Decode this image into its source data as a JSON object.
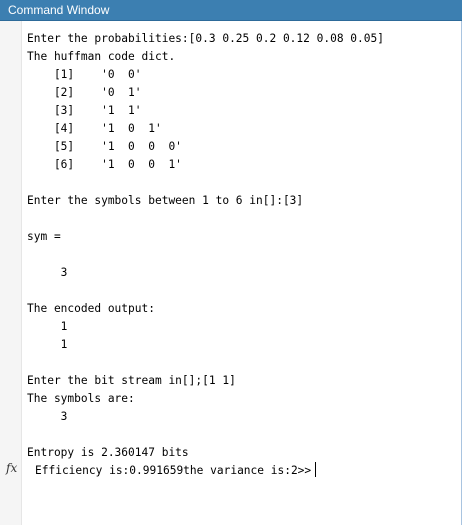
{
  "window": {
    "title": "Command Window"
  },
  "console": {
    "lines": [
      "Enter the probabilities:[0.3 0.25 0.2 0.12 0.08 0.05]",
      "The huffman code dict.",
      "    [1]    '0  0'",
      "    [2]    '0  1'",
      "    [3]    '1  1'",
      "    [4]    '1  0  1'",
      "    [5]    '1  0  0  0'",
      "    [6]    '1  0  0  1'",
      "",
      "Enter the symbols between 1 to 6 in[]:[3]",
      "",
      "sym =",
      "",
      "     3",
      "",
      "The encoded output:",
      "     1",
      "     1",
      "",
      "Enter the bit stream in[];[1 1]",
      "The symbols are:",
      "     3",
      "",
      "Entropy is 2.360147 bits"
    ],
    "prompt_text": "Efficiency is:0.991659the variance is:2>>",
    "fx_label": "fx"
  },
  "colors": {
    "titlebar": "#3c7fb1",
    "title_text": "#ffffff",
    "background": "#ffffff"
  },
  "icons": {
    "fx": "fx-function-browser-icon"
  }
}
